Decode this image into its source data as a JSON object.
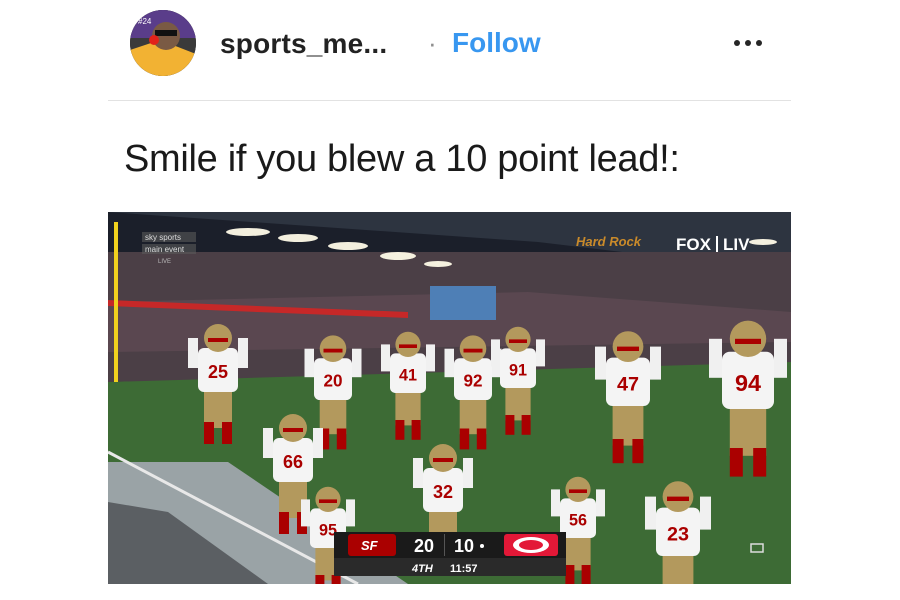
{
  "post": {
    "username": "sports_me...",
    "separator": "·",
    "follow_label": "Follow",
    "caption": "Smile if you blew a 10 point lead!:"
  },
  "broadcast": {
    "network_logo": "FOX",
    "event_logo": "LIV",
    "stadium_sign": "Hard Rock",
    "channel_bug": [
      "sky sports",
      "main event",
      "LIVE"
    ],
    "scoreboard": {
      "home_abbr": "SF",
      "home_score": "20",
      "away_score": "10",
      "quarter": "4TH",
      "clock": "11:57"
    }
  },
  "players": [
    "25",
    "20",
    "41",
    "92",
    "91",
    "47",
    "94",
    "66",
    "32",
    "56",
    "23",
    "95"
  ],
  "colors": {
    "follow_blue": "#3897f0",
    "niners_red": "#aa0000",
    "niners_gold": "#b3995d",
    "chiefs_red": "#e31837",
    "field_green": "#3d6b35"
  },
  "icons": [
    "more-options-icon",
    "avatar"
  ]
}
